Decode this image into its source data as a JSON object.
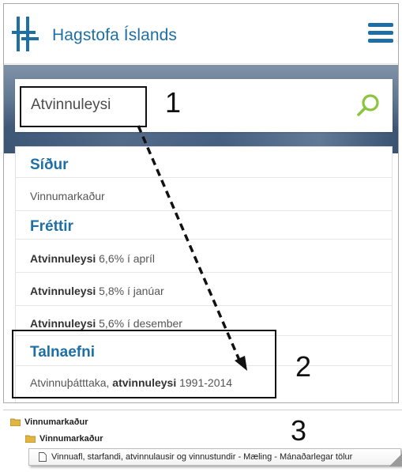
{
  "header": {
    "brand": "Hagstofa Íslands",
    "logo_icon": "hagstofa-logo-icon",
    "menu_icon": "hamburger-menu-icon",
    "brand_color": "#1d6fa5"
  },
  "search": {
    "value": "Atvinnuleysi",
    "icon": "search-icon",
    "icon_color": "#8bc53f"
  },
  "results": {
    "sections": [
      {
        "title": "Síður",
        "items": [
          "Vinnumarkaður"
        ]
      },
      {
        "title": "Fréttir",
        "items": [
          {
            "bold": "Atvinnuleysi",
            "rest": " 6,6% í apríl"
          },
          {
            "bold": "Atvinnuleysi",
            "rest": " 5,8% í janúar"
          },
          {
            "bold": "Atvinnuleysi",
            "rest": " 5,6% í desember"
          }
        ]
      },
      {
        "title": "Talnaefni",
        "items": [
          {
            "pre": "Atvinnuþátttaka, ",
            "bold": "atvinnuleysi",
            "rest": " 1991-2014"
          }
        ]
      }
    ]
  },
  "annotations": {
    "step1": "1",
    "step2": "2",
    "step3": "3"
  },
  "tree": {
    "level1": "Vinnumarkaður",
    "level2": "Vinnumarkaður",
    "leaf": "Vinnuafl, starfandi, atvinnulausir og vinnustundir - Mæling - Mánaðarlegar tölur"
  }
}
